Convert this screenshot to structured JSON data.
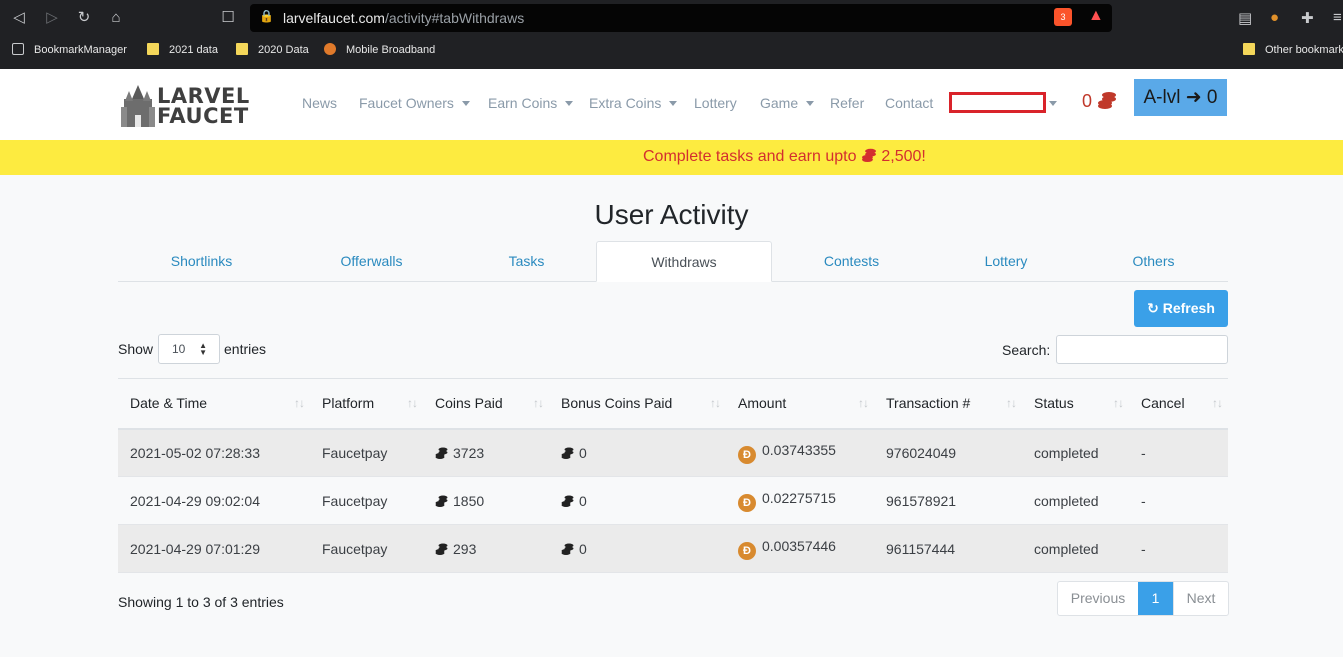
{
  "browser": {
    "url_host": "larvelfaucet.com",
    "url_path": "/activity#tabWithdraws",
    "brave_badge": "3",
    "bookmarks": [
      "BookmarkManager",
      "2021 data",
      "2020 Data",
      "Mobile Broadband"
    ],
    "other_bookmarks": "Other bookmarks"
  },
  "site": {
    "logo_line1": "LARVEL",
    "logo_line2": "FAUCET",
    "nav": {
      "news": "News",
      "faucet_owners": "Faucet Owners",
      "earn_coins": "Earn Coins",
      "extra_coins": "Extra Coins",
      "lottery": "Lottery",
      "game": "Game",
      "refer": "Refer",
      "contact": "Contact"
    },
    "coins_count": "0",
    "level_label": "A-lvl",
    "level_value": "0"
  },
  "banner": {
    "text_before": "Complete tasks and earn upto",
    "amount": "2,500!"
  },
  "page": {
    "title": "User Activity",
    "tabs": [
      "Shortlinks",
      "Offerwalls",
      "Tasks",
      "Withdraws",
      "Contests",
      "Lottery",
      "Others"
    ],
    "active_tab": "Withdraws",
    "refresh_label": "Refresh",
    "show_label": "Show",
    "entries_value": "10",
    "entries_label": "entries",
    "search_label": "Search:",
    "search_value": ""
  },
  "table": {
    "columns": [
      "Date & Time",
      "Platform",
      "Coins Paid",
      "Bonus Coins Paid",
      "Amount",
      "Transaction #",
      "Status",
      "Cancel"
    ],
    "rows": [
      {
        "datetime": "2021-05-02 07:28:33",
        "platform": "Faucetpay",
        "coins": "3723",
        "bonus": "0",
        "amount": "0.03743355",
        "tx": "976024049",
        "status": "completed",
        "cancel": "-"
      },
      {
        "datetime": "2021-04-29 09:02:04",
        "platform": "Faucetpay",
        "coins": "1850",
        "bonus": "0",
        "amount": "0.02275715",
        "tx": "961578921",
        "status": "completed",
        "cancel": "-"
      },
      {
        "datetime": "2021-04-29 07:01:29",
        "platform": "Faucetpay",
        "coins": "293",
        "bonus": "0",
        "amount": "0.00357446",
        "tx": "961157444",
        "status": "completed",
        "cancel": "-"
      }
    ],
    "sort_glyph": "↑↓",
    "coin_icon": "coin-stack-icon",
    "currency_symbol": "Ð"
  },
  "footer": {
    "showing": "Showing 1 to 3 of 3 entries",
    "prev": "Previous",
    "page": "1",
    "next": "Next"
  },
  "colors": {
    "accent": "#3aa0e8",
    "banner_bg": "#fdeb40",
    "banner_text": "#d32f2f",
    "doge": "#d88a2f"
  }
}
